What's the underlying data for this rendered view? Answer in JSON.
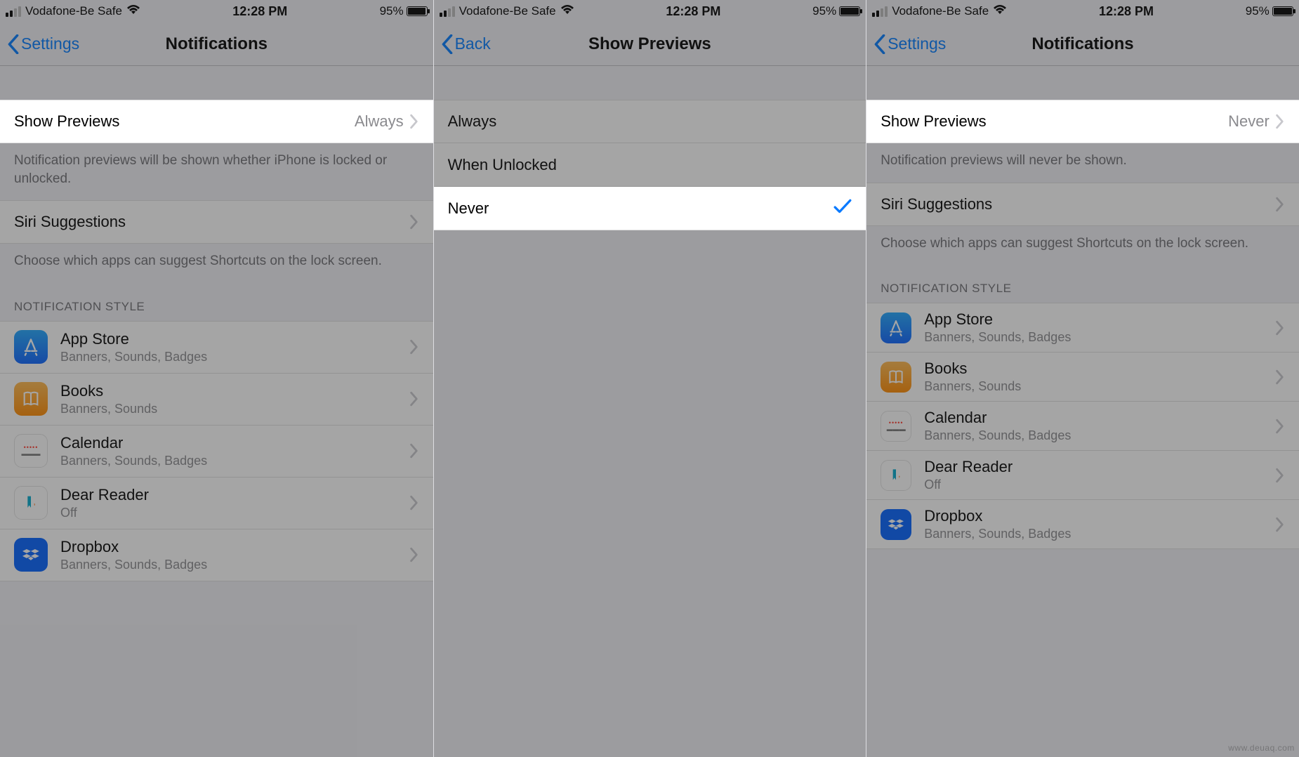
{
  "status": {
    "carrier": "Vodafone-Be Safe",
    "time": "12:28 PM",
    "battery_pct": "95%"
  },
  "screen1": {
    "back_label": "Settings",
    "title": "Notifications",
    "show_previews_label": "Show Previews",
    "show_previews_value": "Always",
    "previews_footer": "Notification previews will be shown whether iPhone is locked or unlocked.",
    "siri_label": "Siri Suggestions",
    "siri_footer": "Choose which apps can suggest Shortcuts on the lock screen.",
    "group_header": "NOTIFICATION STYLE",
    "apps": [
      {
        "name": "App Store",
        "sub": "Banners, Sounds, Badges"
      },
      {
        "name": "Books",
        "sub": "Banners, Sounds"
      },
      {
        "name": "Calendar",
        "sub": "Banners, Sounds, Badges"
      },
      {
        "name": "Dear Reader",
        "sub": "Off"
      },
      {
        "name": "Dropbox",
        "sub": "Banners, Sounds, Badges"
      }
    ]
  },
  "screen2": {
    "back_label": "Back",
    "title": "Show Previews",
    "options": [
      {
        "label": "Always",
        "selected": false
      },
      {
        "label": "When Unlocked",
        "selected": false
      },
      {
        "label": "Never",
        "selected": true
      }
    ]
  },
  "screen3": {
    "back_label": "Settings",
    "title": "Notifications",
    "show_previews_label": "Show Previews",
    "show_previews_value": "Never",
    "previews_footer": "Notification previews will never be shown.",
    "siri_label": "Siri Suggestions",
    "siri_footer": "Choose which apps can suggest Shortcuts on the lock screen.",
    "group_header": "NOTIFICATION STYLE",
    "apps": [
      {
        "name": "App Store",
        "sub": "Banners, Sounds, Badges"
      },
      {
        "name": "Books",
        "sub": "Banners, Sounds"
      },
      {
        "name": "Calendar",
        "sub": "Banners, Sounds, Badges"
      },
      {
        "name": "Dear Reader",
        "sub": "Off"
      },
      {
        "name": "Dropbox",
        "sub": "Banners, Sounds, Badges"
      }
    ]
  },
  "watermark": "www.deuaq.com"
}
